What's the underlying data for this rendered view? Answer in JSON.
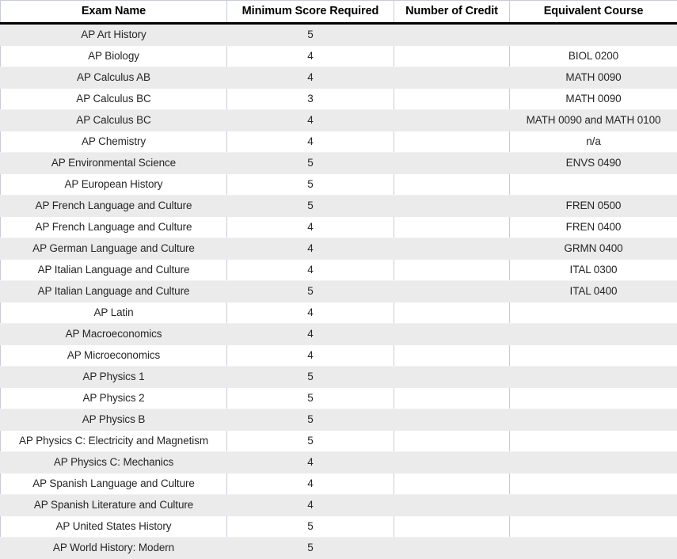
{
  "table": {
    "columns": [
      {
        "key": "exam_name",
        "label": "Exam Name",
        "align": "center"
      },
      {
        "key": "min_score",
        "label": "Minimum Score Required",
        "align": "center"
      },
      {
        "key": "num_credit",
        "label": "Number of Credit",
        "align": "center"
      },
      {
        "key": "equiv_course",
        "label": "Equivalent Course",
        "align": "center"
      }
    ],
    "colors": {
      "header_text": "#000000",
      "header_rule": "#000000",
      "grid_line": "#c8cbd8",
      "row_shaded": "#ebebeb",
      "row_white": "#ffffff",
      "body_text": "#262626"
    },
    "rows": [
      {
        "exam_name": "AP Art History",
        "min_score": "5",
        "num_credit": "",
        "equiv_course": ""
      },
      {
        "exam_name": "AP Biology",
        "min_score": "4",
        "num_credit": "",
        "equiv_course": "BIOL 0200"
      },
      {
        "exam_name": "AP Calculus AB",
        "min_score": "4",
        "num_credit": "",
        "equiv_course": "MATH 0090"
      },
      {
        "exam_name": "AP Calculus BC",
        "min_score": "3",
        "num_credit": "",
        "equiv_course": "MATH 0090"
      },
      {
        "exam_name": "AP Calculus BC",
        "min_score": "4",
        "num_credit": "",
        "equiv_course": "MATH 0090 and MATH 0100"
      },
      {
        "exam_name": "AP Chemistry",
        "min_score": "4",
        "num_credit": "",
        "equiv_course": "n/a"
      },
      {
        "exam_name": "AP Environmental Science",
        "min_score": "5",
        "num_credit": "",
        "equiv_course": "ENVS 0490"
      },
      {
        "exam_name": "AP European History",
        "min_score": "5",
        "num_credit": "",
        "equiv_course": ""
      },
      {
        "exam_name": "AP French Language and Culture",
        "min_score": "5",
        "num_credit": "",
        "equiv_course": "FREN 0500"
      },
      {
        "exam_name": "AP French Language and Culture",
        "min_score": "4",
        "num_credit": "",
        "equiv_course": "FREN 0400"
      },
      {
        "exam_name": "AP German Language and Culture",
        "min_score": "4",
        "num_credit": "",
        "equiv_course": "GRMN 0400"
      },
      {
        "exam_name": "AP Italian Language and Culture",
        "min_score": "4",
        "num_credit": "",
        "equiv_course": "ITAL 0300"
      },
      {
        "exam_name": "AP Italian Language and Culture",
        "min_score": "5",
        "num_credit": "",
        "equiv_course": "ITAL 0400"
      },
      {
        "exam_name": "AP Latin",
        "min_score": "4",
        "num_credit": "",
        "equiv_course": ""
      },
      {
        "exam_name": "AP Macroeconomics",
        "min_score": "4",
        "num_credit": "",
        "equiv_course": ""
      },
      {
        "exam_name": "AP Microeconomics",
        "min_score": "4",
        "num_credit": "",
        "equiv_course": ""
      },
      {
        "exam_name": "AP Physics 1",
        "min_score": "5",
        "num_credit": "",
        "equiv_course": ""
      },
      {
        "exam_name": "AP Physics 2",
        "min_score": "5",
        "num_credit": "",
        "equiv_course": ""
      },
      {
        "exam_name": "AP Physics B",
        "min_score": "5",
        "num_credit": "",
        "equiv_course": ""
      },
      {
        "exam_name": "AP Physics C: Electricity and Magnetism",
        "min_score": "5",
        "num_credit": "",
        "equiv_course": ""
      },
      {
        "exam_name": "AP Physics C: Mechanics",
        "min_score": "4",
        "num_credit": "",
        "equiv_course": ""
      },
      {
        "exam_name": "AP Spanish Language and Culture",
        "min_score": "4",
        "num_credit": "",
        "equiv_course": ""
      },
      {
        "exam_name": "AP Spanish Literature and Culture",
        "min_score": "4",
        "num_credit": "",
        "equiv_course": ""
      },
      {
        "exam_name": "AP United States History",
        "min_score": "5",
        "num_credit": "",
        "equiv_course": ""
      },
      {
        "exam_name": "AP World History: Modern",
        "min_score": "5",
        "num_credit": "",
        "equiv_course": ""
      }
    ]
  }
}
